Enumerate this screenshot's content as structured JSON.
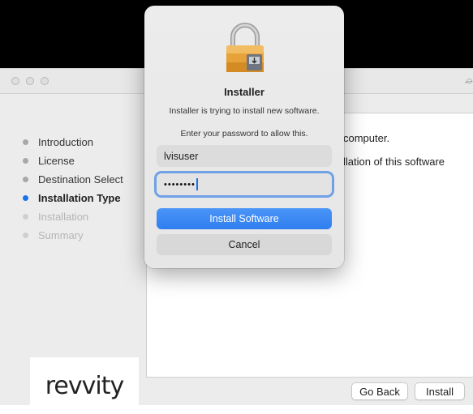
{
  "installer_window": {
    "sidebar": {
      "steps": [
        {
          "label": "Introduction",
          "state": "done"
        },
        {
          "label": "License",
          "state": "done"
        },
        {
          "label": "Destination Select",
          "state": "done"
        },
        {
          "label": "Installation Type",
          "state": "active"
        },
        {
          "label": "Installation",
          "state": "pending"
        },
        {
          "label": "Summary",
          "state": "pending"
        }
      ],
      "logo_text": "revvity"
    },
    "content": {
      "line1": "computer.",
      "line2": "llation of this software"
    },
    "buttons": {
      "go_back": "Go Back",
      "install": "Install"
    }
  },
  "auth_dialog": {
    "title": "Installer",
    "message": "Installer is trying to install new software.",
    "prompt": "Enter your password to allow this.",
    "username": "lvisuser",
    "password_masked": "••••••••",
    "install_button": "Install Software",
    "cancel_button": "Cancel"
  },
  "colors": {
    "accent": "#2f7ef0",
    "focus_ring": "#6fa1e6",
    "active_step_dot": "#1a73e8",
    "lock_body": "#e8a23a"
  },
  "icons": {
    "dialog_icon": "lock-icon"
  }
}
